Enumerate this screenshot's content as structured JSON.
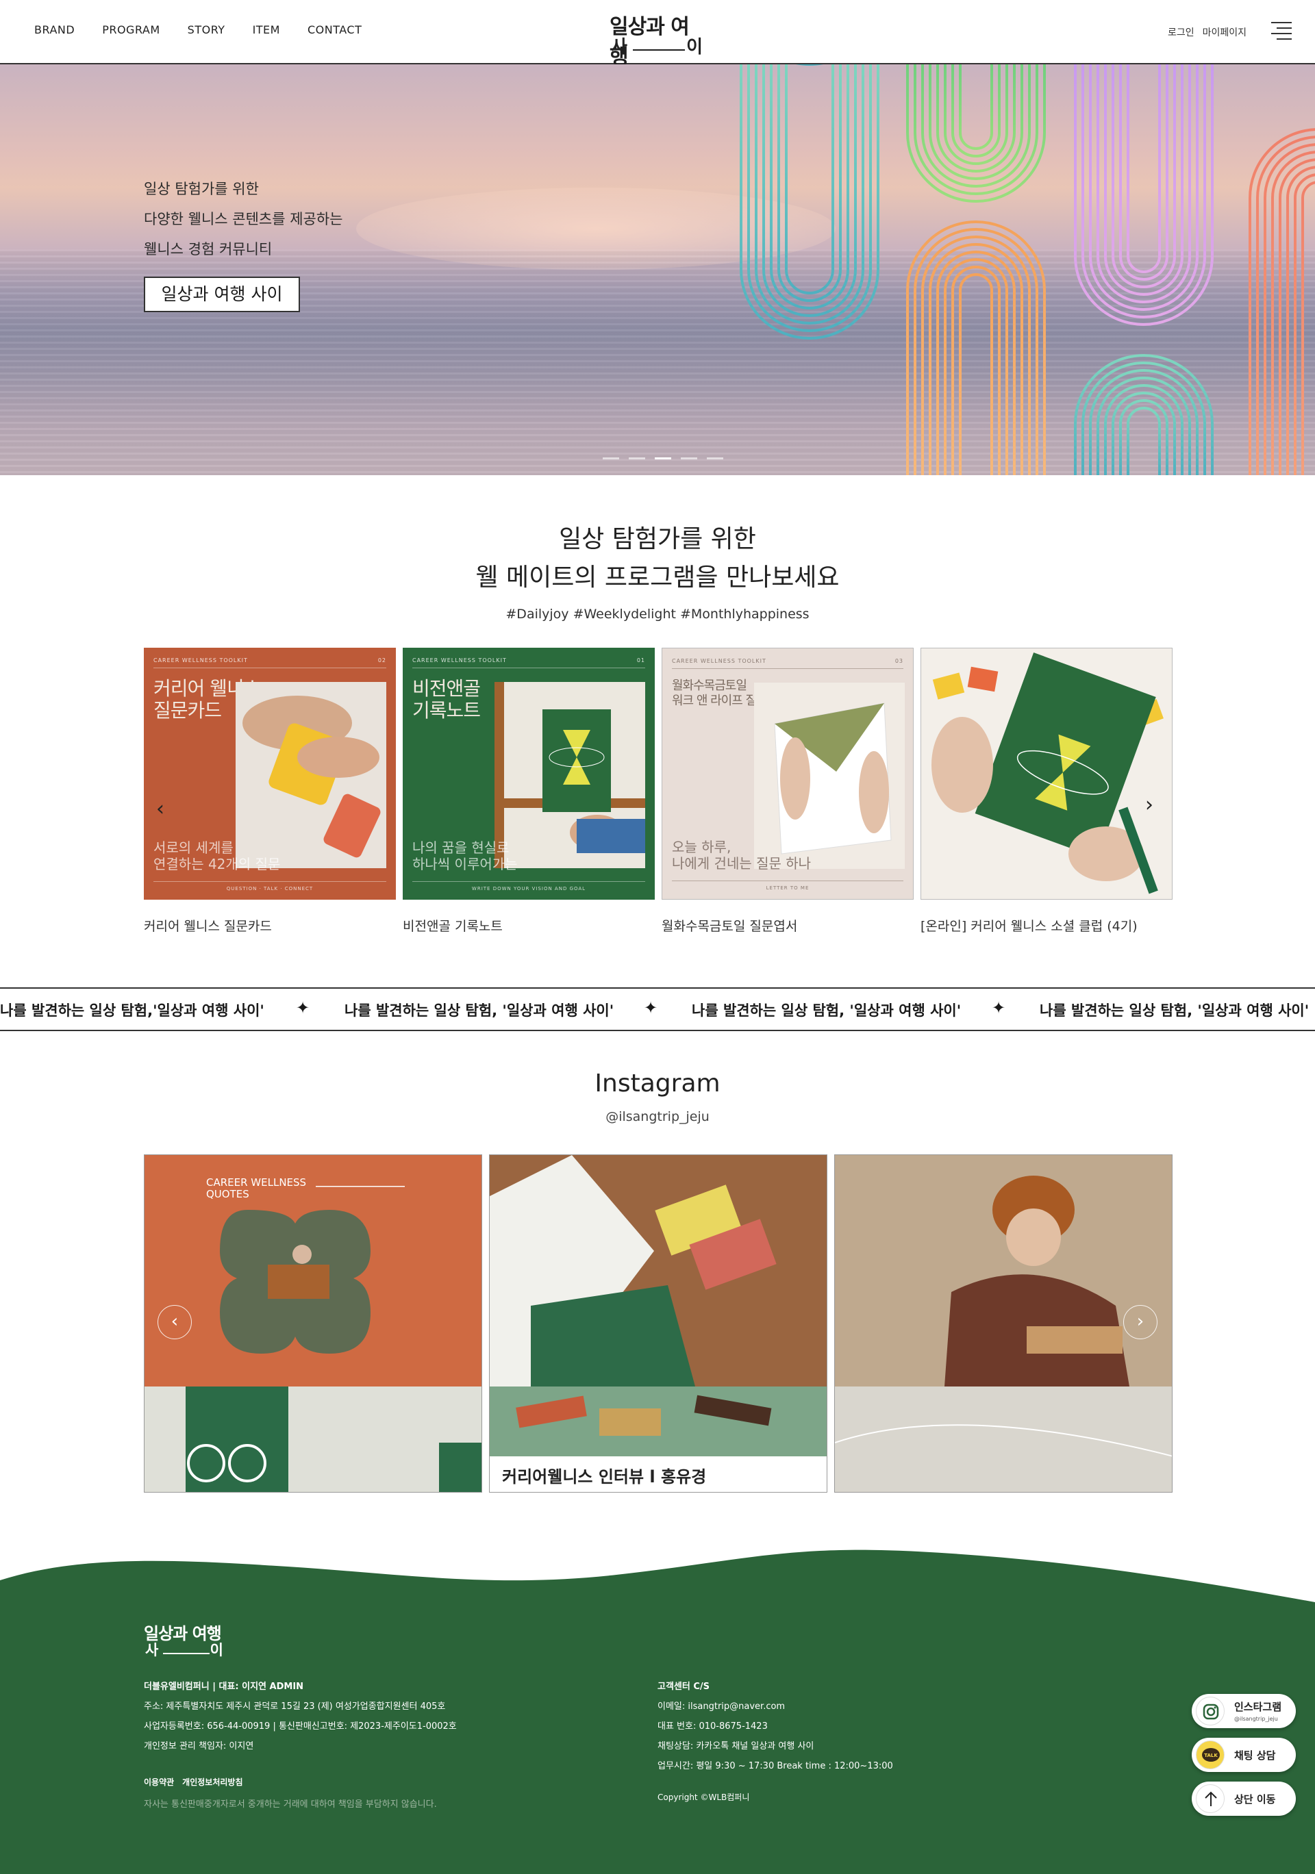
{
  "header": {
    "nav": [
      "BRAND",
      "PROGRAM",
      "STORY",
      "ITEM",
      "CONTACT"
    ],
    "logo_top": "일상과 여행",
    "logo_bottom_left": "사",
    "logo_bottom_right": "이",
    "login": "로그인",
    "mypage": "마이페이지"
  },
  "hero": {
    "lines": [
      "일상 탐험가를 위한",
      "다양한 웰니스 콘텐츠를 제공하는",
      "웰니스 경험 커뮤니티"
    ],
    "button": "일상과 여행 사이",
    "slide_count": 5,
    "active_slide": 3
  },
  "program": {
    "title_line1": "일상 탐험가를 위한",
    "title_line2": "웰 메이트의 프로그램을 만나보세요",
    "tags": "#Dailyjoy #Weeklydelight #Monthlyhappiness",
    "cards": [
      {
        "label": "커리어 웰니스 질문카드",
        "header": "CAREER WELLNESS TOOLKIT",
        "num": "02",
        "title": "커리어 웰니스\n질문카드",
        "sub": "서로의 세계를\n연결하는 42개의 질문",
        "foot": "QUESTION · TALK · CONNECT",
        "bg": "#bd5a38"
      },
      {
        "label": "비전앤골 기록노트",
        "header": "CAREER WELLNESS TOOLKIT",
        "num": "01",
        "title": "비전앤골\n기록노트",
        "sub": "나의 꿈을 현실로\n하나씩 이루어가는",
        "foot": "WRITE DOWN YOUR VISION AND GOAL",
        "bg": "#2a6b3c"
      },
      {
        "label": "월화수목금토일 질문엽서",
        "header": "CAREER WELLNESS TOOLKIT",
        "num": "03",
        "title": "월화수목금토일\n워크 앤 라이프 질문엽서",
        "sub": "오늘 하루,\n나에게 건네는 질문 하나",
        "foot": "LETTER TO ME",
        "bg": "#e8ddd7"
      },
      {
        "label": "[온라인] 커리어 웰니스 소셜 클럽 (4기)",
        "header": "",
        "num": "",
        "title": "",
        "sub": "",
        "foot": "",
        "bg": "#f4f0ea"
      }
    ]
  },
  "marquee": [
    "나를 발견하는 일상 탐험,'일상과 여행 사이'",
    "나를 발견하는 일상 탐험, '일상과 여행 사이'",
    "나를 발견하는 일상 탐험, '일상과 여행 사이'",
    "나를 발견하는 일상 탐험, '일상과 여행 사이'"
  ],
  "instagram": {
    "title": "Instagram",
    "handle": "@ilsangtrip_jeju",
    "post1_text": "CAREER WELLNESS\nQUOTES",
    "post2_caption": "커리어웰니스 인터뷰 l 홍유경"
  },
  "footer": {
    "company_line": "더블유엘비컴퍼니  |  대표: 이지연  ADMIN",
    "address": "주소: 제주특별자치도 제주시 관덕로 15길 23 (제) 여성가업종합지원센터 405호",
    "biz": "사업자등록번호: 656-44-00919 | 통신판매신고번호: 제2023-제주이도1-0002호",
    "privacy_officer": "개인정보 관리 책임자: 이지연",
    "links": [
      "이용약관",
      "개인정보처리방침"
    ],
    "notice": "자사는 통신판매중개자로서 중개하는 거래에 대하여 책임을 부담하지 않습니다.",
    "cs_title": "고객센터 C/S",
    "email": "이메일: ilsangtrip@naver.com",
    "phone": "대표 번호: 010-8675-1423",
    "chat": "채팅상담: 카카오톡 채널 일상과 여행 사이",
    "hours": "업무시간: 평일 9:30 ~ 17:30 Break time : 12:00~13:00",
    "copyright": "Copyright ©WLB컴퍼니",
    "bg": "#2b6439"
  },
  "quick": {
    "instagram_label": "인스타그램",
    "instagram_sub": "@ilsangtrip_jeju",
    "chat_label": "채팅 상담",
    "top_label": "상단 이동"
  }
}
